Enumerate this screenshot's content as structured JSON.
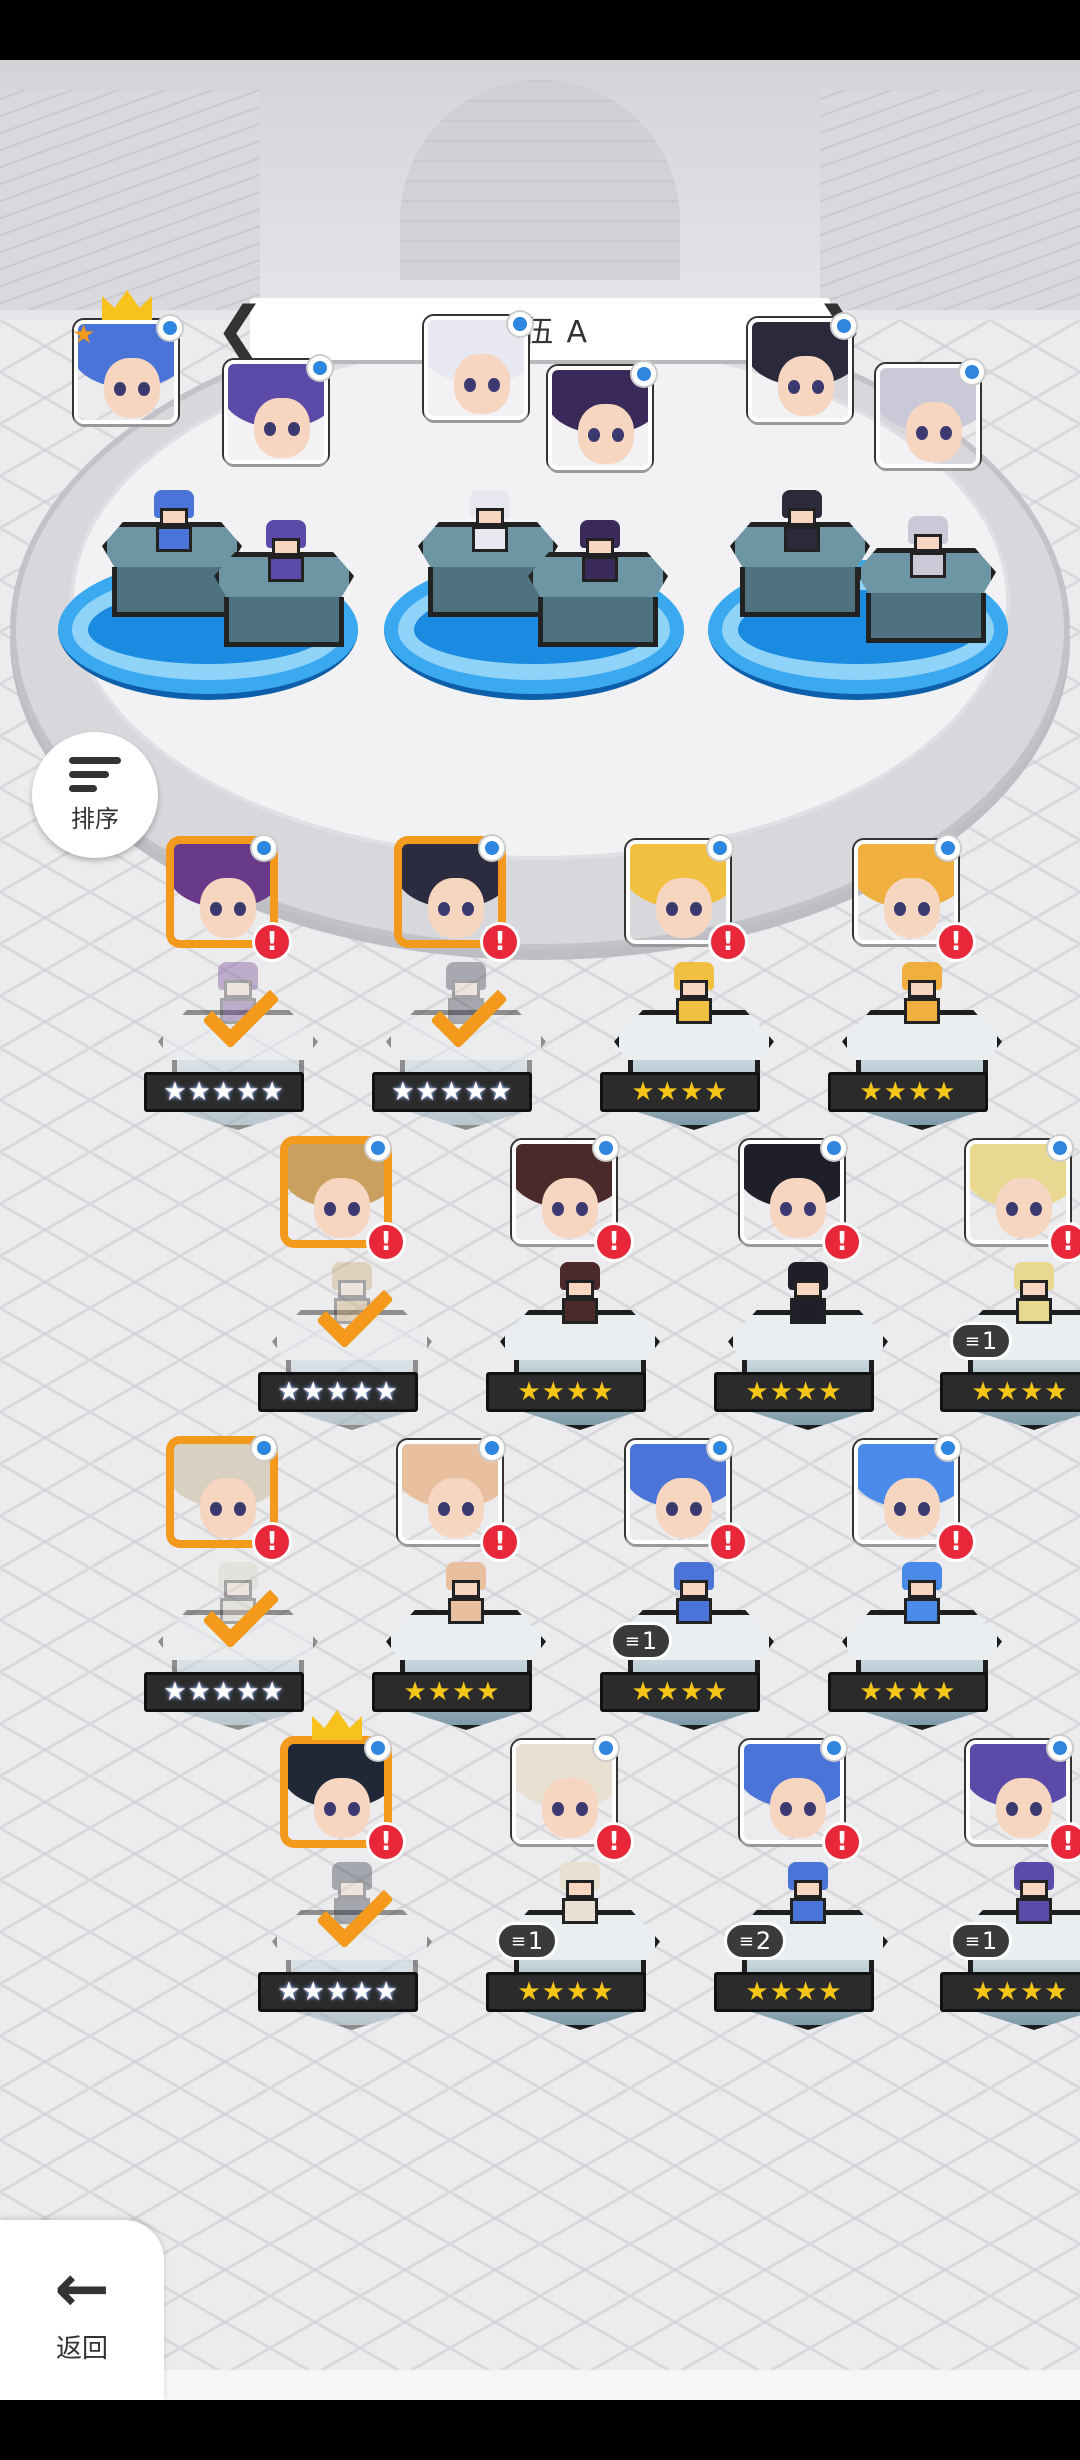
{
  "team": {
    "title": "队伍 A",
    "prev_arrow": "❮",
    "next_arrow": "❯"
  },
  "sort": {
    "label": "排序"
  },
  "back": {
    "label": "返回",
    "icon": "←"
  },
  "roster": {
    "alert_mark": "!",
    "rows": [
      [
        {
          "stars": "★★★★★",
          "rainbow": true,
          "selected": true,
          "dupe": ""
        },
        {
          "stars": "★★★★★",
          "rainbow": true,
          "selected": true,
          "dupe": ""
        },
        {
          "stars": "★★★★",
          "rainbow": false,
          "selected": false,
          "dupe": ""
        },
        {
          "stars": "★★★★",
          "rainbow": false,
          "selected": false,
          "dupe": ""
        }
      ],
      [
        {
          "stars": "★★★★★",
          "rainbow": true,
          "selected": true,
          "dupe": ""
        },
        {
          "stars": "★★★★",
          "rainbow": false,
          "selected": false,
          "dupe": ""
        },
        {
          "stars": "★★★★",
          "rainbow": false,
          "selected": false,
          "dupe": ""
        },
        {
          "stars": "★★★★",
          "rainbow": false,
          "selected": false,
          "dupe": "1"
        }
      ],
      [
        {
          "stars": "★★★★★",
          "rainbow": true,
          "selected": true,
          "dupe": ""
        },
        {
          "stars": "★★★★",
          "rainbow": false,
          "selected": false,
          "dupe": ""
        },
        {
          "stars": "★★★★",
          "rainbow": false,
          "selected": false,
          "dupe": "1"
        },
        {
          "stars": "★★★★",
          "rainbow": false,
          "selected": false,
          "dupe": ""
        }
      ],
      [
        {
          "stars": "★★★★★",
          "rainbow": true,
          "selected": true,
          "dupe": ""
        },
        {
          "stars": "★★★★",
          "rainbow": false,
          "selected": false,
          "dupe": "1"
        },
        {
          "stars": "★★★★",
          "rainbow": false,
          "selected": false,
          "dupe": "2"
        },
        {
          "stars": "★★★★",
          "rainbow": false,
          "selected": false,
          "dupe": "1"
        }
      ]
    ]
  },
  "colors": {
    "selected_border": "#f39a1d",
    "alert": "#e8283a",
    "pool_blue": "#1a8be0",
    "star_gold": "#f5c518"
  }
}
